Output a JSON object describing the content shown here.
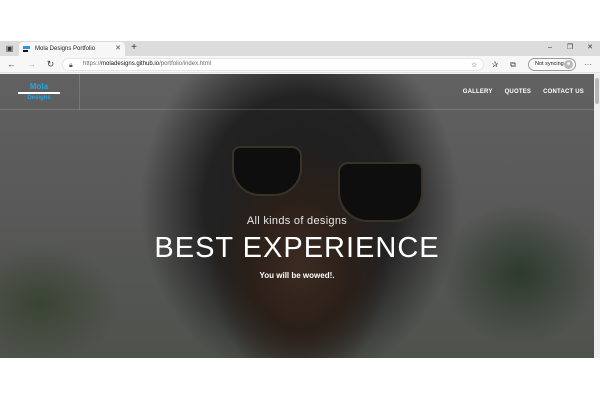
{
  "browser": {
    "tab": {
      "title": "Mola Designs Portfolio"
    },
    "window_controls": {
      "minimize": "–",
      "maximize": "❐",
      "close": "✕"
    },
    "address": {
      "prefix": "https://",
      "host": "moladesigns.github.io",
      "path": "/portfolio/index.html"
    },
    "sync_label": "Not syncing"
  },
  "site": {
    "logo": {
      "top": "Mola",
      "bottom": "Designs"
    },
    "nav": [
      {
        "label": "GALLERY"
      },
      {
        "label": "QUOTES"
      },
      {
        "label": "CONTACT US"
      }
    ]
  },
  "hero": {
    "subtitle": "All kinds of designs",
    "title": "BEST EXPERIENCE",
    "tagline": "You will be wowed!.",
    "slides": {
      "count": 3,
      "active": 3
    }
  },
  "colors": {
    "accent": "#29a3e0"
  }
}
